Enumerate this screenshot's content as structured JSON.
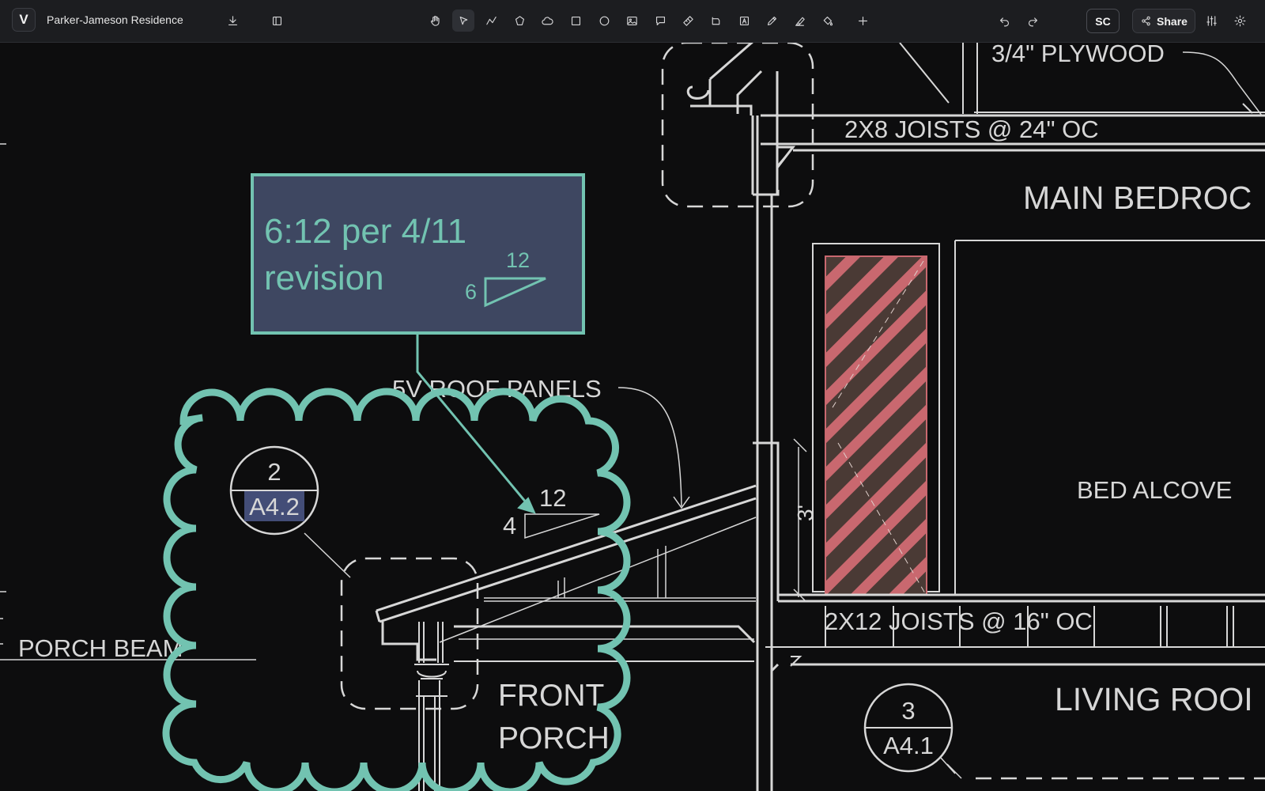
{
  "app": {
    "logo": "V",
    "document_title": "Parker-Jameson Residence"
  },
  "toolbar": {
    "left_tools": [
      "download-icon",
      "sidebar-toggle-icon"
    ],
    "tools": [
      "hand-icon",
      "select-pointer-icon",
      "polyline-icon",
      "polygon-icon",
      "cloud-icon",
      "rectangle-icon",
      "ellipse-icon",
      "image-icon",
      "callout-icon",
      "measure-ruler-icon",
      "area-icon",
      "text-box-icon",
      "pen-icon",
      "highlighter-icon",
      "fill-bucket-icon",
      "add-icon"
    ],
    "active_tool": "select-pointer-icon",
    "right_tools": [
      "undo-icon",
      "redo-icon"
    ],
    "user_initials": "SC",
    "share_label": "Share",
    "settings_tools": [
      "adjustments-icon",
      "settings-icon"
    ]
  },
  "drawing": {
    "labels": {
      "plywood": "3/4\" PLYWOOD",
      "joists_top": "2X8 JOISTS @ 24\" OC",
      "main_bedroom": "MAIN BEDROC",
      "bed_alcove": "BED ALCOVE",
      "roof_panels": "5V ROOF PANELS",
      "porch_beam": "PORCH BEAM",
      "joists_bottom": "2X12 JOISTS @ 16\" OC",
      "front_porch_1": "FRONT",
      "front_porch_2": "PORCH",
      "living_room": "LIVING ROOI",
      "dim_3ft": "3'",
      "slope_rise": "4",
      "slope_run": "12"
    },
    "section_markers": [
      {
        "number": "2",
        "sheet": "A4.2"
      },
      {
        "number": "3",
        "sheet": "A4.1"
      }
    ]
  },
  "markup": {
    "callout_line1": "6:12 per 4/11",
    "callout_line2": "revision",
    "callout_rise": "6",
    "callout_run": "12"
  },
  "colors": {
    "markup_teal": "#72c3b1",
    "callout_fill": "#3e4761",
    "hatch_red": "#c9686f",
    "hatch_bg": "#4a3a35",
    "line_work": "#d7d7d7",
    "canvas_bg": "#0d0d0e",
    "highlight": "#434d77"
  }
}
